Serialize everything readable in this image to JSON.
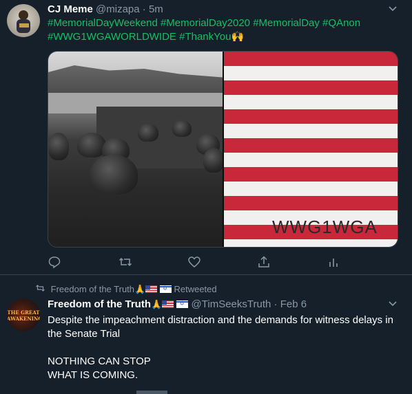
{
  "tweet1": {
    "name": "CJ Meme",
    "handle": "@mizapa",
    "separator": "·",
    "time": "5m",
    "hashtags_line1": "#MemorialDayWeekend #MemorialDay2020 #MemorialDay #QAnon",
    "hashtags_line2": "#WWG1WGAWORLDWIDE #ThankYou",
    "hands_emoji": "🙌",
    "image_text": "WWG1WGA",
    "actions": [
      "reply-icon",
      "retweet-icon",
      "like-icon",
      "share-icon",
      "analytics-icon"
    ]
  },
  "retweet_banner": {
    "who": "Freedom of the Truth",
    "emoji": "🙏",
    "suffix": "Retweeted"
  },
  "tweet2": {
    "avatar_text": "THE GREAT AWAKENING",
    "name": "Freedom of the Truth",
    "emoji": "🙏",
    "handle": "@TimSeeksTruth",
    "separator": "·",
    "time": "Feb 6",
    "line1": "Despite the impeachment distraction and the demands for witness delays in",
    "line2": "the Senate Trial",
    "line3": "NOTHING CAN STOP",
    "line4": "WHAT IS COMING."
  },
  "colors": {
    "background": "#15202b",
    "hashtag": "#17bf63",
    "muted": "#8899a6",
    "divider": "#38444d"
  }
}
